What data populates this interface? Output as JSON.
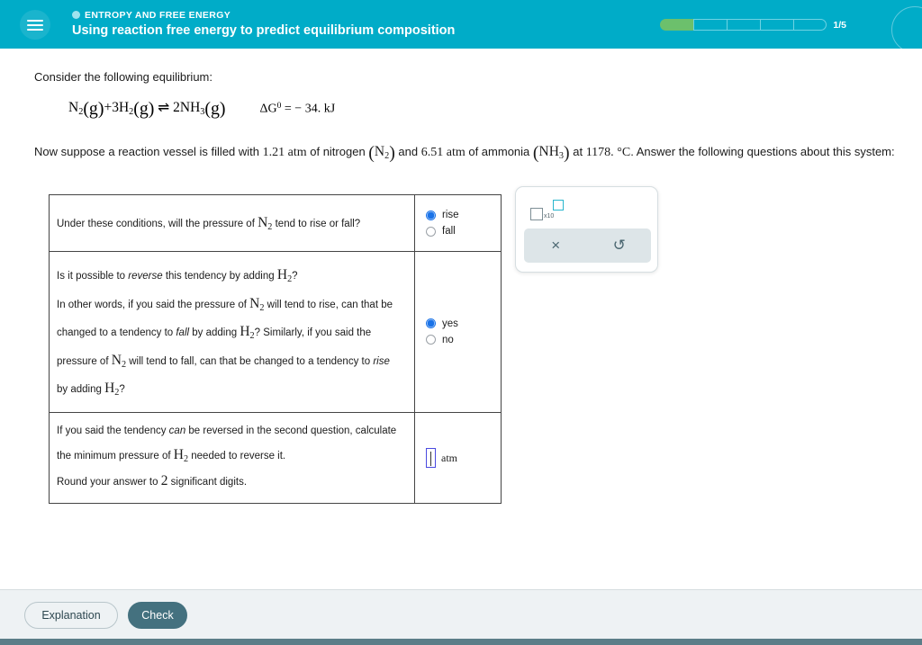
{
  "header": {
    "eyebrow": "ENTROPY AND FREE ENERGY",
    "title": "Using reaction free energy to predict equilibrium composition",
    "progress_label": "1/5",
    "progress_total": 5,
    "progress_filled": 1,
    "accent_color": "#00ACC8",
    "progress_fill_color": "#6cc06c",
    "menu_icon": "hamburger-icon",
    "eyebrow_dot_icon": "status-dot-icon"
  },
  "intro": {
    "lead": "Consider the following equilibrium:",
    "equation": {
      "reactant1": "N",
      "reactant1_sub": "2",
      "state1": "(g)",
      "plus": "+",
      "coeff2": "3",
      "reactant2": "H",
      "reactant2_sub": "2",
      "state2": "(g)",
      "arrow": "⇌",
      "coeff3": "2",
      "product": "NH",
      "product_sub": "3",
      "state3": "(g)"
    },
    "delta_g": {
      "symbol": "ΔG",
      "superscript": "0",
      "equals": "=",
      "value": "− 34. kJ"
    },
    "problem_part1": "Now suppose a reaction vessel is filled with ",
    "pressure_n2": "1.21",
    "unit_atm": "atm",
    "problem_part2": " of nitrogen ",
    "gas1": "N",
    "gas1_sub": "2",
    "problem_part3": " and ",
    "pressure_nh3": "6.51",
    "problem_part4": " of ammonia ",
    "gas2": "NH",
    "gas2_sub": "3",
    "problem_part5": " at ",
    "temperature": "1178.",
    "temperature_unit": "°C",
    "problem_part6": ". Answer the following questions about this system:"
  },
  "table": {
    "rows": [
      {
        "id": "row-rise-fall",
        "question_part1": "Under these conditions, will the pressure of ",
        "question_symbol": "N",
        "question_symbol_sub": "2",
        "question_part2": " tend to rise or fall?",
        "options": [
          {
            "label": "rise",
            "selected": true
          },
          {
            "label": "fall",
            "selected": false
          }
        ]
      },
      {
        "id": "row-reverse",
        "line1_a": "Is it possible to ",
        "line1_em": "reverse",
        "line1_b": " this tendency by adding ",
        "line1_sym": "H",
        "line1_sub": "2",
        "line1_c": "?",
        "line2_a": "In other words, if you said the pressure of ",
        "line2_sym": "N",
        "line2_sub": "2",
        "line2_b": " will tend to rise, can that be",
        "line3_a": "changed to a tendency to ",
        "line3_em": "fall",
        "line3_b": " by adding ",
        "line3_sym": "H",
        "line3_sub": "2",
        "line3_c": "? Similarly, if you said the",
        "line4_a": "pressure of ",
        "line4_sym": "N",
        "line4_sub": "2",
        "line4_b": " will tend to fall, can that be changed to a tendency to ",
        "line4_em": "rise",
        "line5_a": "by adding ",
        "line5_sym": "H",
        "line5_sub": "2",
        "line5_b": "?",
        "options": [
          {
            "label": "yes",
            "selected": true
          },
          {
            "label": "no",
            "selected": false
          }
        ]
      },
      {
        "id": "row-min-pressure",
        "line1_a": "If you said the tendency ",
        "line1_em": "can",
        "line1_b": " be reversed in the second question, calculate",
        "line2_a": "the minimum pressure of ",
        "line2_sym": "H",
        "line2_sub": "2",
        "line2_b": " needed to reverse it.",
        "line3_a": "Round your answer to ",
        "line3_num": "2",
        "line3_b": " significant digits.",
        "answer_value": "",
        "answer_placeholder": "",
        "answer_unit": "atm"
      }
    ]
  },
  "float_panel": {
    "sci_notation_icon": "scientific-notation-icon",
    "sci_notation_label": "x10",
    "clear_icon": "×",
    "undo_icon": "↺"
  },
  "footer": {
    "explanation_label": "Explanation",
    "check_label": "Check",
    "check_color": "#44717f"
  }
}
